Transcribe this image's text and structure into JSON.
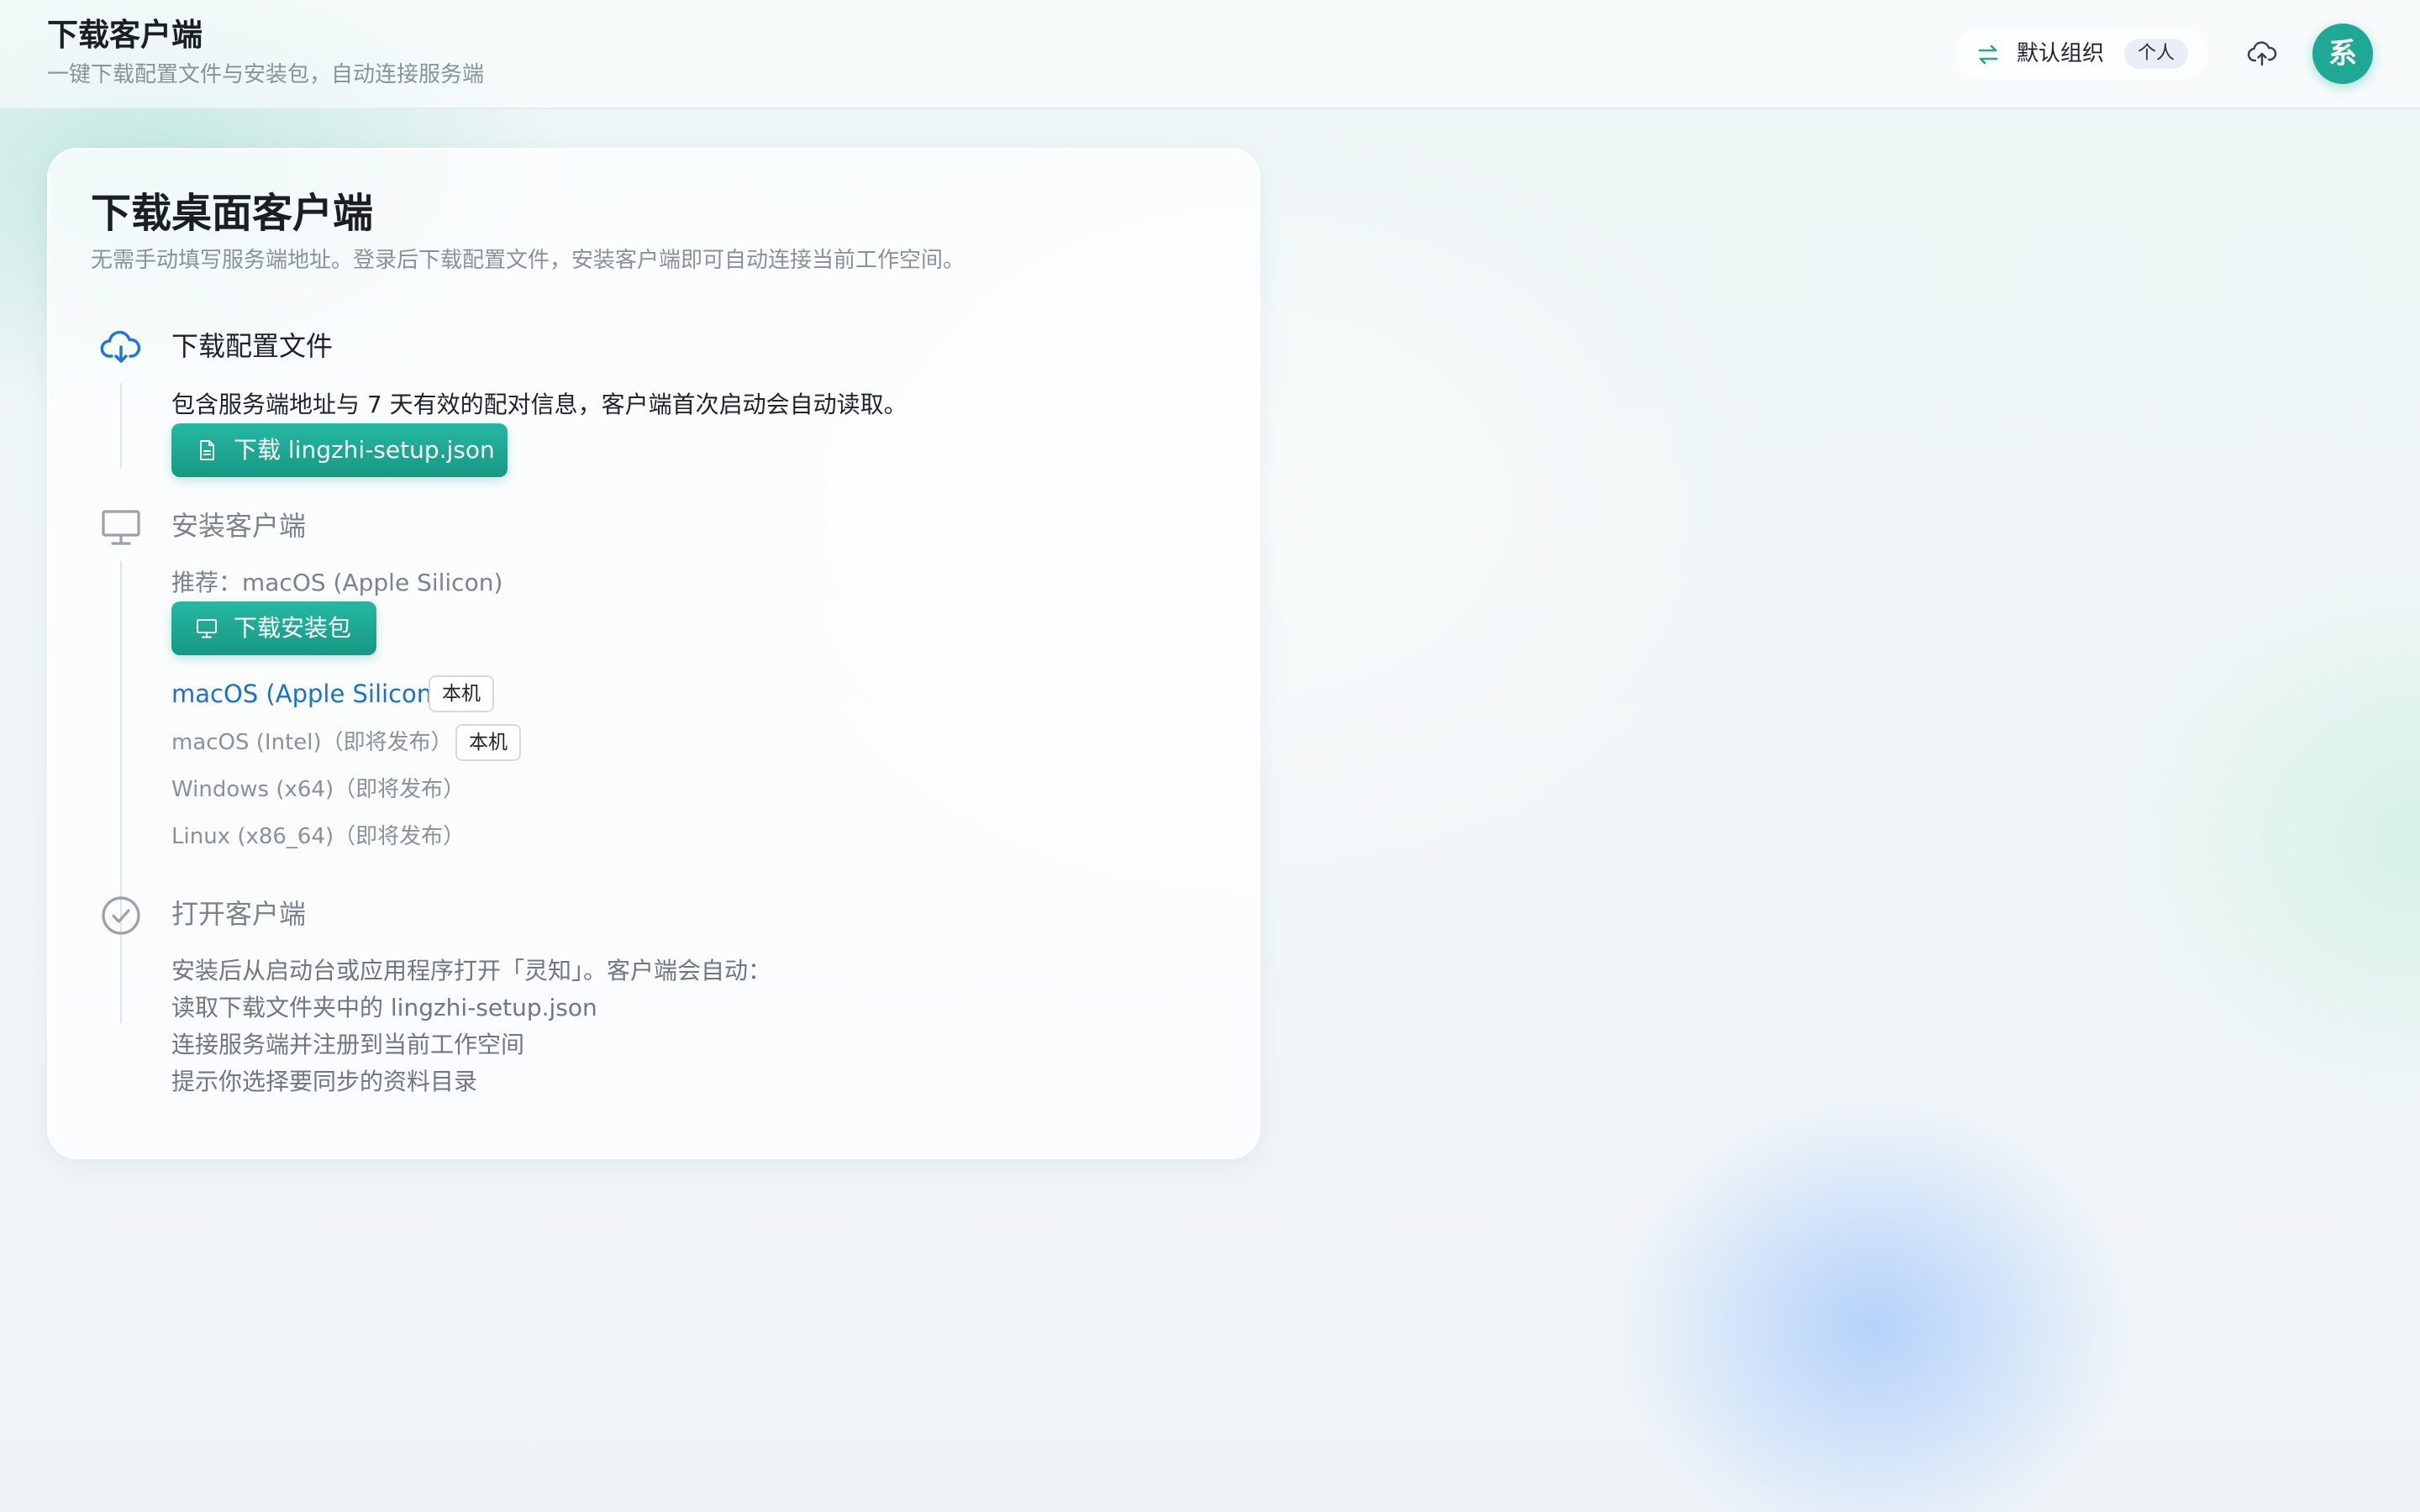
{
  "header": {
    "title": "下载客户端",
    "subtitle": "一键下载配置文件与安装包，自动连接服务端",
    "org_name": "默认组织",
    "org_badge": "个人",
    "avatar_text": "系"
  },
  "card": {
    "title": "下载桌面客户端",
    "description": "无需手动填写服务端地址。登录后下载配置文件，安装客户端即可自动连接当前工作空间。"
  },
  "steps": [
    {
      "title": "下载配置文件",
      "text": "包含服务端地址与 7 天有效的配对信息，客户端首次启动会自动读取。",
      "button_label": "下载 lingzhi-setup.json",
      "icon": "cloud-download-icon"
    },
    {
      "title": "安装客户端",
      "recommend": "推荐：macOS (Apple Silicon)",
      "button_label": "下载安装包",
      "icon": "monitor-icon",
      "platforms": [
        {
          "label": "macOS (Apple Silicon)",
          "tag": "本机"
        },
        {
          "label": "macOS (Intel)（即将发布）",
          "tag": "本机"
        },
        {
          "label": "Windows (x64)（即将发布）"
        },
        {
          "label": "Linux (x86_64)（即将发布）"
        }
      ]
    },
    {
      "title": "打开客户端",
      "icon": "check-circle-icon",
      "lines": [
        "安装后从启动台或应用程序打开「灵知」。客户端会自动：",
        "读取下载文件夹中的 lingzhi-setup.json",
        "连接服务端并注册到当前工作空间",
        "提示你选择要同步的资料目录"
      ]
    }
  ],
  "colors": {
    "accent": "#1fa890",
    "link": "#1a6fd8",
    "muted": "#8a9299"
  }
}
